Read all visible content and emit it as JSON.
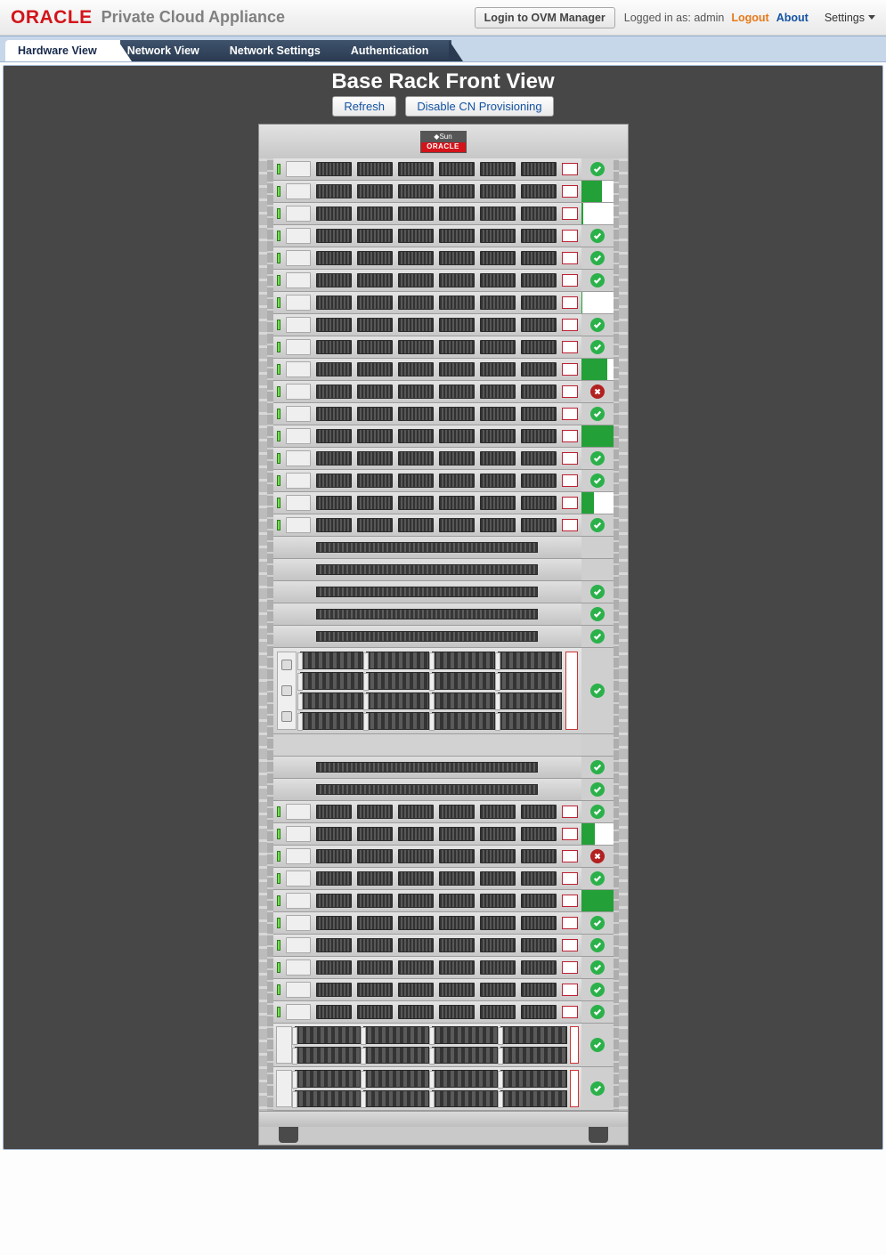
{
  "header": {
    "brand": "ORACLE",
    "app_title": "Private Cloud Appliance",
    "login_ovm_label": "Login to OVM Manager",
    "logged_in_prefix": "Logged in as: ",
    "logged_in_user": "admin",
    "logout_label": "Logout",
    "about_label": "About",
    "settings_label": "Settings"
  },
  "tabs": [
    {
      "id": "hardware",
      "label": "Hardware View",
      "active": true
    },
    {
      "id": "network",
      "label": "Network View",
      "active": false
    },
    {
      "id": "netsettings",
      "label": "Network Settings",
      "active": false
    },
    {
      "id": "auth",
      "label": "Authentication",
      "active": false
    }
  ],
  "page": {
    "title": "Base Rack Front View",
    "refresh_label": "Refresh",
    "disable_cn_label": "Disable CN Provisioning"
  },
  "rack_badge": {
    "top": "◆Sun",
    "bottom": "ORACLE"
  },
  "slots": [
    {
      "t": "srv",
      "status": "ok"
    },
    {
      "t": "srv",
      "status": "bar",
      "pct": 65
    },
    {
      "t": "srv",
      "status": "bar",
      "pct": 6
    },
    {
      "t": "srv",
      "status": "ok"
    },
    {
      "t": "srv",
      "status": "ok"
    },
    {
      "t": "srv",
      "status": "ok"
    },
    {
      "t": "srv",
      "status": "bar",
      "pct": 4
    },
    {
      "t": "srv",
      "status": "ok"
    },
    {
      "t": "srv",
      "status": "ok"
    },
    {
      "t": "srv",
      "status": "bar",
      "pct": 82
    },
    {
      "t": "srv",
      "status": "err"
    },
    {
      "t": "srv",
      "status": "ok"
    },
    {
      "t": "srv",
      "status": "bar",
      "pct": 100
    },
    {
      "t": "srv",
      "status": "ok"
    },
    {
      "t": "srv",
      "status": "ok"
    },
    {
      "t": "srv",
      "status": "bar",
      "pct": 40
    },
    {
      "t": "srv",
      "status": "ok"
    },
    {
      "t": "sw",
      "status": "none"
    },
    {
      "t": "sw",
      "status": "none"
    },
    {
      "t": "sw",
      "status": "ok"
    },
    {
      "t": "sw",
      "status": "ok"
    },
    {
      "t": "sw",
      "status": "ok"
    },
    {
      "t": "st4",
      "status": "ok"
    },
    {
      "t": "empty",
      "status": "none"
    },
    {
      "t": "sw",
      "status": "ok"
    },
    {
      "t": "sw",
      "status": "ok"
    },
    {
      "t": "srv",
      "status": "ok"
    },
    {
      "t": "srv",
      "status": "bar",
      "pct": 42
    },
    {
      "t": "srv",
      "status": "err"
    },
    {
      "t": "srv",
      "status": "ok"
    },
    {
      "t": "srv",
      "status": "bar",
      "pct": 100
    },
    {
      "t": "srv",
      "status": "ok"
    },
    {
      "t": "srv",
      "status": "ok"
    },
    {
      "t": "srv",
      "status": "ok"
    },
    {
      "t": "srv",
      "status": "ok"
    },
    {
      "t": "srv",
      "status": "ok"
    },
    {
      "t": "st2",
      "status": "ok"
    },
    {
      "t": "st2",
      "status": "ok"
    }
  ]
}
